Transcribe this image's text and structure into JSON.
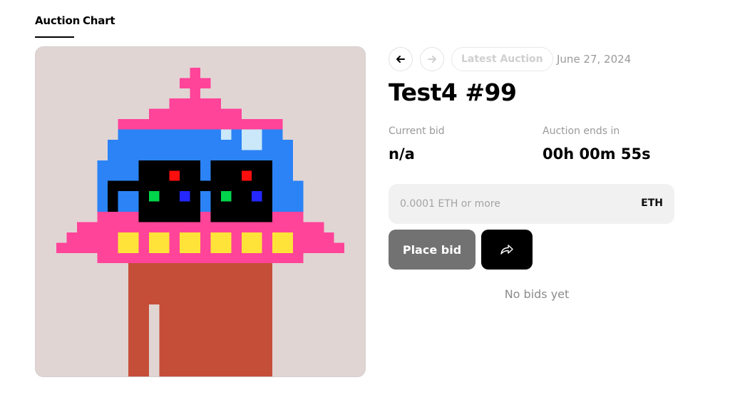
{
  "tabs": [
    {
      "label": "Auction",
      "active": true
    },
    {
      "label": "Chart",
      "active": false
    }
  ],
  "artwork": {
    "background_color": "#e1d5d4",
    "palette": {
      "pink": "#ff4499",
      "blue": "#2b83f6",
      "black": "#000000",
      "yellow": "#ffe339",
      "brown": "#c54e38",
      "highlight": "#cae8fa",
      "red": "#ff0e0e",
      "green": "#00d54b",
      "indigo": "#2427ff"
    }
  },
  "nav": {
    "prev_icon": "arrow-left-icon",
    "next_icon": "arrow-right-icon",
    "latest_label": "Latest Auction",
    "date": "June 27, 2024"
  },
  "auction": {
    "title": "Test4 #99",
    "current_bid_label": "Current bid",
    "current_bid_value": "n/a",
    "ends_label": "Auction ends in",
    "ends_value": "00h 00m 55s"
  },
  "bid": {
    "placeholder": "0.0001 ETH or more",
    "value": "",
    "currency": "ETH",
    "place_label": "Place bid",
    "share_icon": "share-icon"
  },
  "bids": {
    "empty_text": "No bids yet"
  },
  "colors": {
    "place_bid_bg": "#727272",
    "share_bg": "#000000",
    "muted_text": "#9a9a9a"
  }
}
